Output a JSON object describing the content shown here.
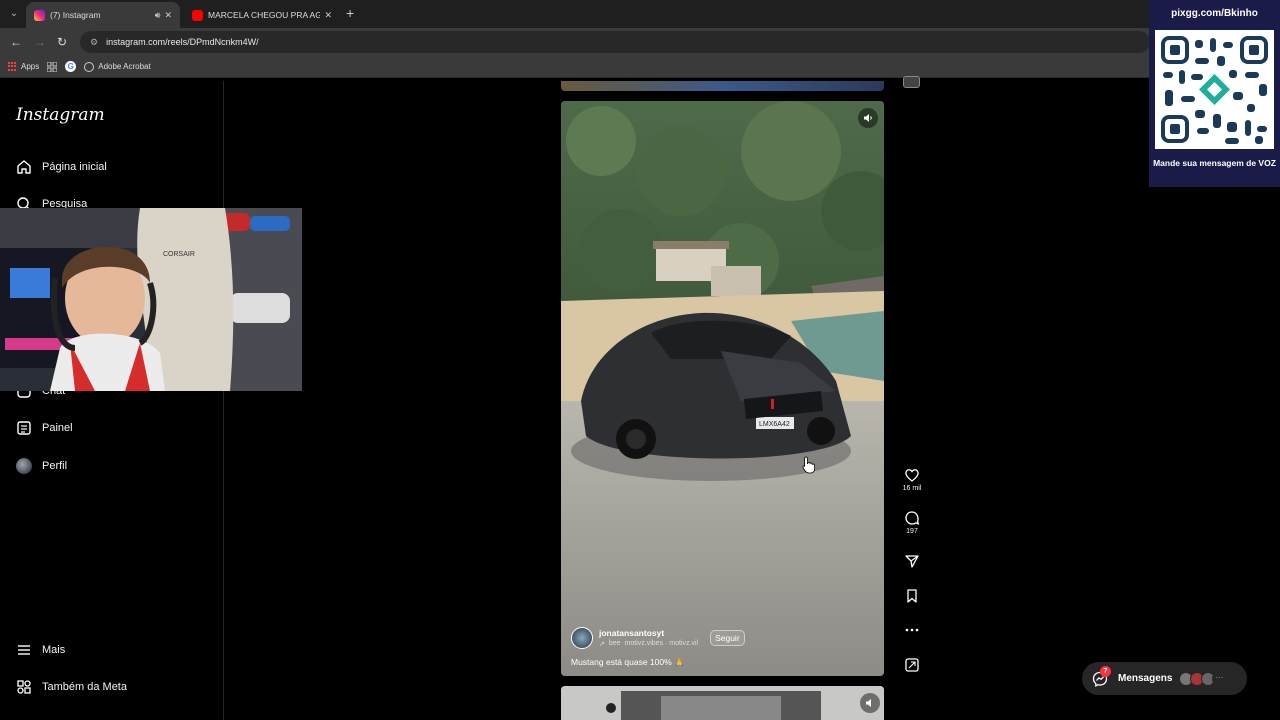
{
  "browser": {
    "tabs": [
      {
        "title": "(7) Instagram",
        "active": true
      },
      {
        "title": "MARCELA CHEGOU PRA AGILIZ",
        "active": false
      }
    ],
    "url": "instagram.com/reels/DPmdNcnkm4W/",
    "bookmarks": {
      "apps": "Apps",
      "acrobat": "Adobe Acrobat"
    }
  },
  "sidebar": {
    "logo": "Instagram",
    "items": [
      {
        "label": "Página inicial",
        "icon": "home-icon"
      },
      {
        "label": "Pesquisa",
        "icon": "search-icon"
      },
      {
        "label": "Chat",
        "icon": "chat-icon"
      },
      {
        "label": "Painel",
        "icon": "dashboard-icon"
      },
      {
        "label": "Perfil",
        "icon": "profile-avatar"
      }
    ],
    "bottom": [
      {
        "label": "Mais",
        "icon": "menu-icon"
      },
      {
        "label": "Também da Meta",
        "icon": "meta-icon"
      }
    ]
  },
  "reel": {
    "author": "jonatansantosyt",
    "music": "motivz.vibes · motivz.vil",
    "music_prefix": "bee",
    "follow": "Seguir",
    "caption": "Mustang está quase 100% 🙏",
    "plate": "LMX6A42"
  },
  "actions": {
    "likes": "16 mil",
    "comments": "197"
  },
  "pix": {
    "title": "pixgg.com/Bkinho",
    "message": "Mande sua mensagem de VOZ"
  },
  "messages": {
    "label": "Mensagens",
    "badge": "7"
  },
  "colors": {
    "background": "#000000",
    "sidebar_border": "#262626",
    "pix_panel": "#1b1b4a",
    "notification": "#ff3040"
  }
}
